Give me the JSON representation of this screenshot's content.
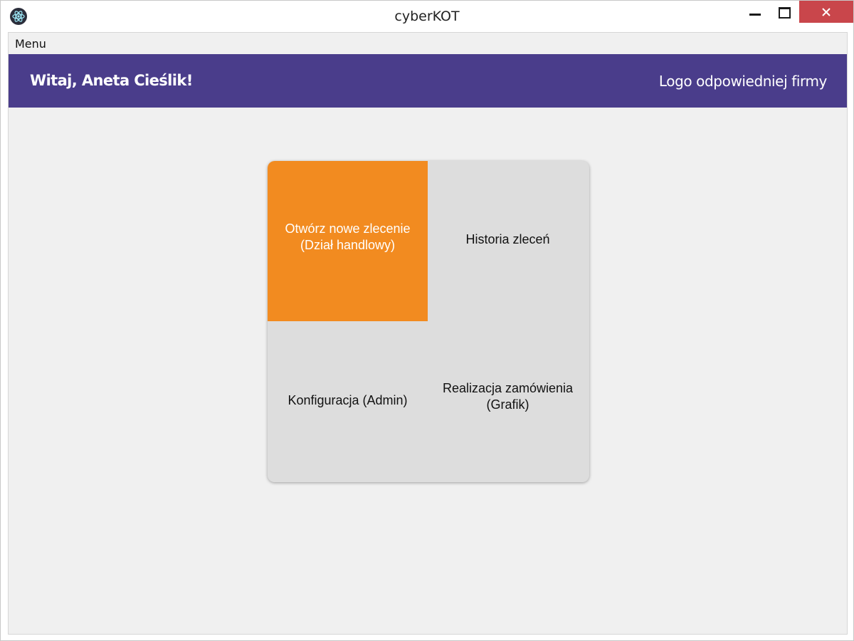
{
  "window": {
    "title": "cyberKOT",
    "icon": "electron-atom-icon",
    "controls": [
      "minimize-icon",
      "maximize-icon",
      "close-icon"
    ],
    "close_color": "#c9464b"
  },
  "menubar": {
    "items": [
      {
        "label": "Menu"
      }
    ]
  },
  "header": {
    "greeting": "Witaj, Aneta Cieślik!",
    "logo_text": "Logo odpowiedniej firmy",
    "background": "#4a3d8b"
  },
  "tiles": [
    {
      "label": "Otwórz nowe zlecenie (Dział handlowy)",
      "active": true,
      "color": "#f28b20"
    },
    {
      "label": "Historia zleceń",
      "active": false,
      "color": "#dddddd"
    },
    {
      "label": "Konfiguracja (Admin)",
      "active": false,
      "color": "#dddddd"
    },
    {
      "label": "Realizacja zamówienia (Grafik)",
      "active": false,
      "color": "#dddddd"
    }
  ]
}
